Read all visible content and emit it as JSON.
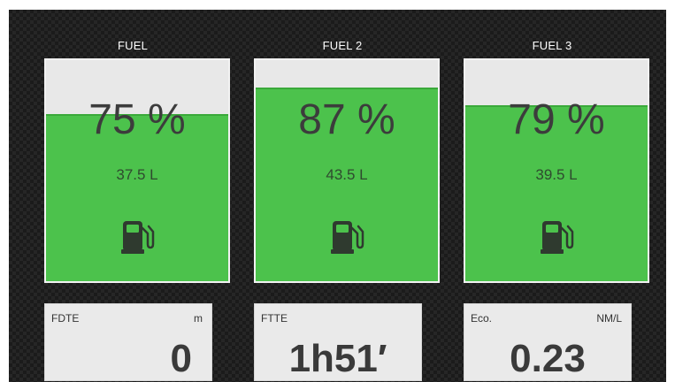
{
  "tanks": [
    {
      "title": "FUEL",
      "percent_label": "75 %",
      "volume": "37.5 L",
      "level": 0.75,
      "icon": "fuel-pump-icon"
    },
    {
      "title": "FUEL 2",
      "percent_label": "87 %",
      "volume": "43.5 L",
      "level": 0.87,
      "icon": "fuel-pump-icon"
    },
    {
      "title": "FUEL 3",
      "percent_label": "79 %",
      "volume": "39.5 L",
      "level": 0.79,
      "icon": "fuel-pump-icon"
    }
  ],
  "databoxes": [
    {
      "label": "FDTE",
      "unit": "m",
      "value": "0"
    },
    {
      "label": "FTTE",
      "unit": "",
      "value": "1h51′"
    },
    {
      "label": "Eco.",
      "unit": "NM/L",
      "value": "0.23"
    }
  ],
  "colors": {
    "background": "#1b1b1b",
    "tank_fill": "#4cc24c",
    "tank_empty": "#e8e8e8",
    "databox": "#eaeaea",
    "text_dark": "#3c3c3c"
  }
}
